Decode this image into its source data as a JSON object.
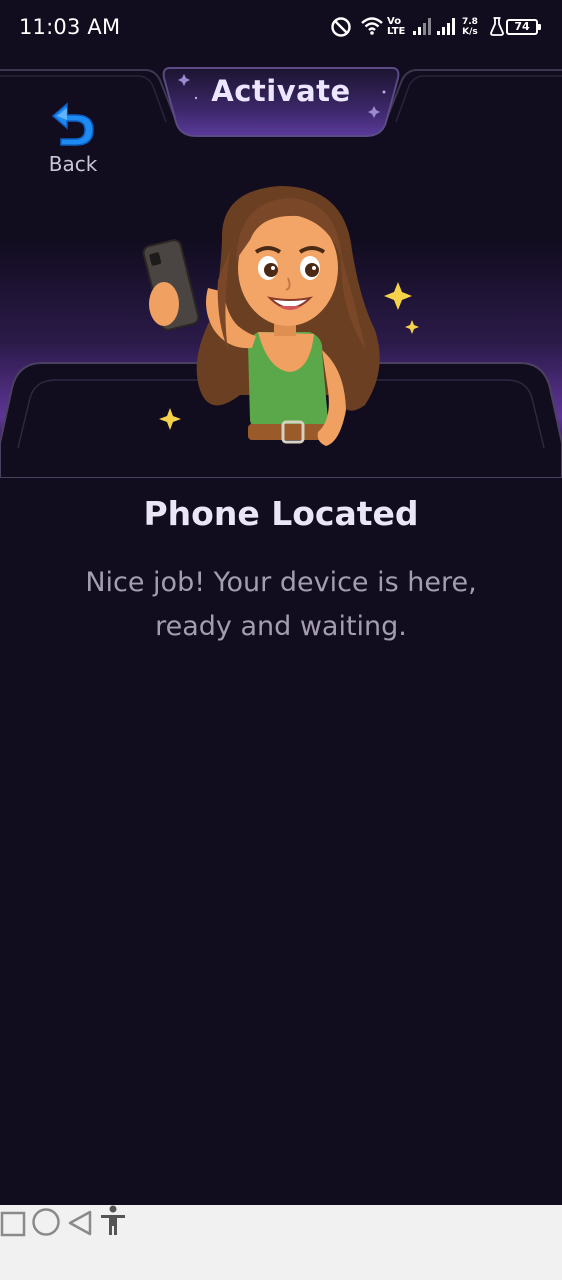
{
  "status_bar": {
    "time": "11:03 AM",
    "network_speed_value": "7.8",
    "network_speed_unit": "K/s",
    "volte_top": "Vo",
    "volte_bottom": "LTE",
    "battery_level": "74",
    "icons": [
      "dnd-icon",
      "wifi-icon",
      "volte-icon",
      "signal-icon",
      "signal-icon",
      "flask-icon",
      "battery-icon"
    ]
  },
  "header": {
    "tab_title": "Activate",
    "back_label": "Back",
    "back_icon": "undo-arrow-icon"
  },
  "main": {
    "title": "Phone Located",
    "subtitle": "Nice job! Your device is here, ready and waiting."
  },
  "nav_bar": {
    "icons": [
      "recents-icon",
      "home-icon",
      "back-triangle-icon",
      "accessibility-icon"
    ]
  },
  "colors": {
    "background": "#110c1e",
    "accent_purple": "#6a3fae",
    "back_icon_blue": "#1e8bf2",
    "title": "#ebe6f7",
    "subtitle": "#a39dae",
    "nav_background": "#f1f1f1"
  }
}
